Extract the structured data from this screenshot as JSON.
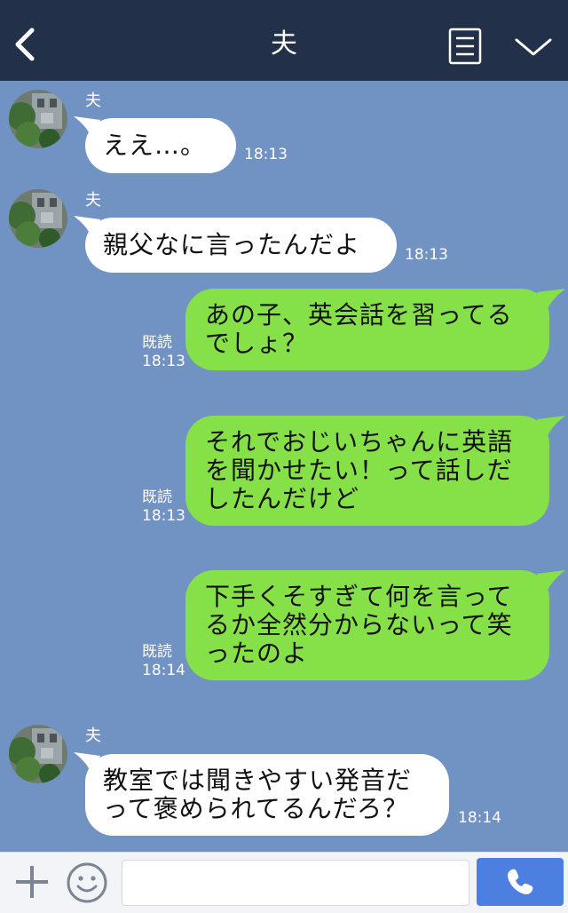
{
  "header": {
    "title": "夫",
    "back_icon": "chevron-left-icon",
    "menu_icon": "note-list-icon",
    "collapse_icon": "chevron-down-icon",
    "background": "#233049"
  },
  "colors": {
    "chat_background": "#7193c3",
    "incoming_bubble": "#ffffff",
    "outgoing_bubble": "#86e048",
    "send_button": "#4d7fe0"
  },
  "messages": [
    {
      "direction": "incoming",
      "sender": "夫",
      "lines": [
        "ええ…。"
      ],
      "time": "18:13"
    },
    {
      "direction": "incoming",
      "sender": "夫",
      "lines": [
        "親父なに言ったんだよ"
      ],
      "time": "18:13"
    },
    {
      "direction": "outgoing",
      "read": "既読",
      "lines": [
        "あの子、英会話を習ってる",
        "でしょ？"
      ],
      "time": "18:13"
    },
    {
      "direction": "outgoing",
      "read": "既読",
      "lines": [
        "それでおじいちゃんに英語",
        "を聞かせたい！って話しだ",
        "したんだけど"
      ],
      "time": "18:13"
    },
    {
      "direction": "outgoing",
      "read": "既読",
      "lines": [
        "下手くそすぎて何を言って",
        "るか全然分からないって笑",
        "ったのよ"
      ],
      "time": "18:14"
    },
    {
      "direction": "incoming",
      "sender": "夫",
      "lines": [
        "教室では聞きやすい発音だ",
        "って褒められてるんだろ？"
      ],
      "time": "18:14"
    }
  ],
  "footer": {
    "plus_icon": "plus-icon",
    "emoji_icon": "smiley-icon",
    "input_value": "",
    "call_icon": "phone-icon"
  }
}
